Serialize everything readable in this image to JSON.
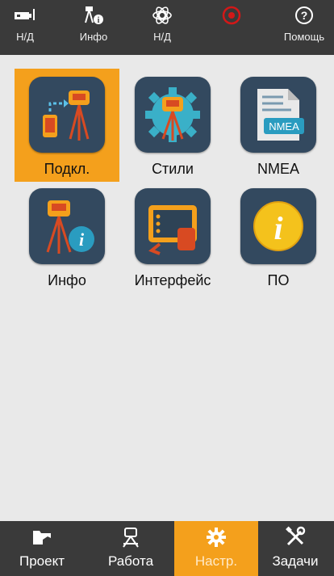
{
  "status_bar": {
    "items": [
      {
        "label": "Н/Д",
        "icon": "battery-icon"
      },
      {
        "label": "Инфо",
        "icon": "satellite-info-icon"
      },
      {
        "label": "Н/Д",
        "icon": "network-icon"
      },
      {
        "label": "",
        "icon": "record-icon"
      },
      {
        "label": "Помощь",
        "icon": "help-icon"
      }
    ]
  },
  "apps": [
    {
      "label": "Подкл.",
      "icon": "connect-icon",
      "selected": true
    },
    {
      "label": "Стили",
      "icon": "styles-icon"
    },
    {
      "label": "NMEA",
      "icon": "nmea-icon",
      "badge": "NMEA"
    },
    {
      "label": "Инфо",
      "icon": "receiver-info-icon"
    },
    {
      "label": "Интерфейс",
      "icon": "interface-icon"
    },
    {
      "label": "ПО",
      "icon": "software-icon"
    }
  ],
  "bottom_nav": {
    "tabs": [
      {
        "label": "Проект",
        "icon": "folder-icon"
      },
      {
        "label": "Работа",
        "icon": "survey-icon"
      },
      {
        "label": "Настр.",
        "icon": "settings-icon",
        "active": true
      },
      {
        "label": "Задачи",
        "icon": "tools-icon"
      }
    ]
  },
  "colors": {
    "accent": "#f4a01c",
    "bar": "#3a3a3a",
    "app_bg": "#33495f",
    "record_red": "#d21818"
  }
}
